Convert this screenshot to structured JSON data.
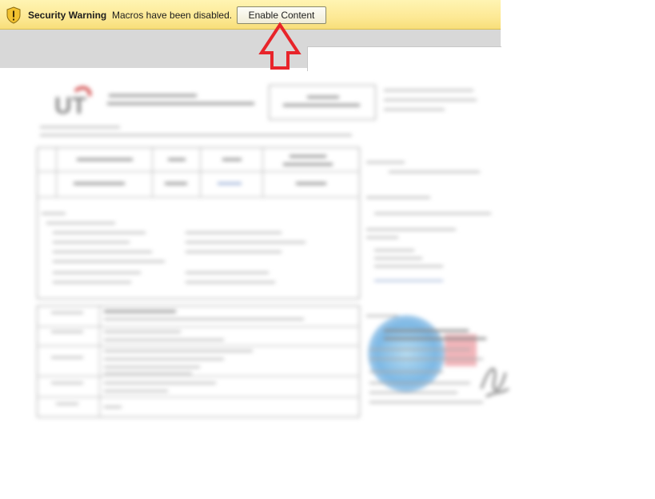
{
  "security_bar": {
    "icon": "shield-warning-icon",
    "title": "Security Warning",
    "message": "Macros have been disabled.",
    "button_label": "Enable Content"
  },
  "colors": {
    "bar_background": "#fde995",
    "arrow": "#e8242a",
    "workspace": "#d8d8d8"
  },
  "document": {
    "state": "blurred",
    "logo_text": "UT"
  }
}
